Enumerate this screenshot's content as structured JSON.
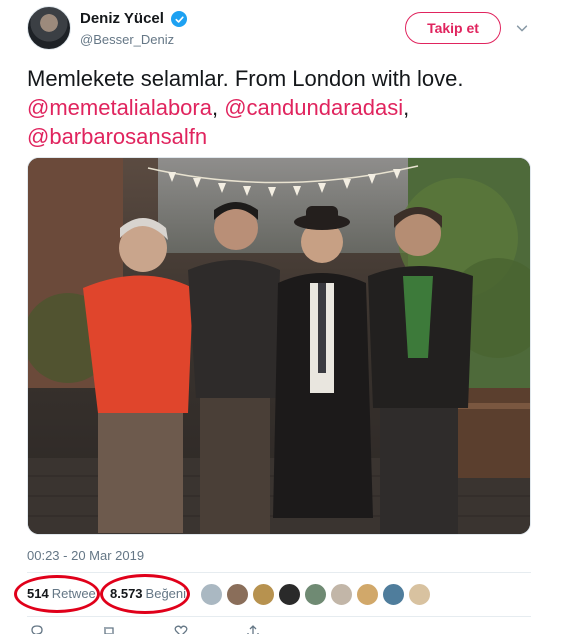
{
  "author": {
    "name": "Deniz Yücel",
    "handle": "@Besser_Deniz",
    "verified": true
  },
  "follow_button_label": "Takip et",
  "tweet": {
    "text_line": "Memlekete selamlar. From London with love.",
    "mentions": [
      "@memetalialabora",
      "@candundaradasi",
      "@barbarosansalfn"
    ],
    "separator": ", ",
    "timestamp": "00:23 - 20 Mar 2019"
  },
  "stats": {
    "retweets_count": "514",
    "retweets_label": "Retwee",
    "likes_count": "8.573",
    "likes_label": "Beğeni"
  },
  "colors": {
    "accent": "#e0245e",
    "verified": "#1da1f2",
    "annotation_red": "#e0001a",
    "muted_text": "#657786"
  },
  "icons": [
    "verified-badge-icon",
    "chevron-down-icon",
    "reply-icon",
    "retweet-icon",
    "like-icon",
    "share-icon"
  ]
}
